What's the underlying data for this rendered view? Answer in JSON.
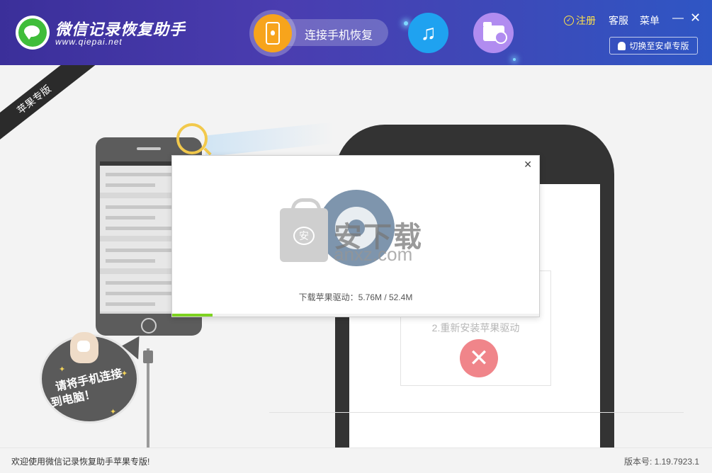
{
  "header": {
    "app_title": "微信记录恢复助手",
    "app_url": "www.qiepai.net",
    "connect_label": "连接手机恢复",
    "register_label": "注册",
    "service_label": "客服",
    "menu_label": "菜单",
    "minimize_glyph": "—",
    "close_glyph": "✕",
    "switch_label": "切换至安卓专版",
    "music_glyph": "♫",
    "colors": {
      "bg_start": "#3b2f9a",
      "bg_end": "#2f56c4",
      "accent": "#f7a41c",
      "register": "#ffe14a"
    }
  },
  "main": {
    "edition_ribbon": "苹果专版",
    "bubble_line1": "请将手机连接",
    "bubble_line2": "到电脑！",
    "card_step": "2.重新安装苹果驱动",
    "card_x": "✕"
  },
  "dialog": {
    "close_glyph": "✕",
    "watermark_text": "安下载",
    "watermark_domain": "anxz.com",
    "watermark_bag_char": "安",
    "status": "下载苹果驱动：5.76M / 52.4M",
    "progress_fraction": 0.11
  },
  "footer": {
    "welcome": "欢迎使用微信记录恢复助手苹果专版!",
    "version": "版本号: 1.19.7923.1"
  }
}
